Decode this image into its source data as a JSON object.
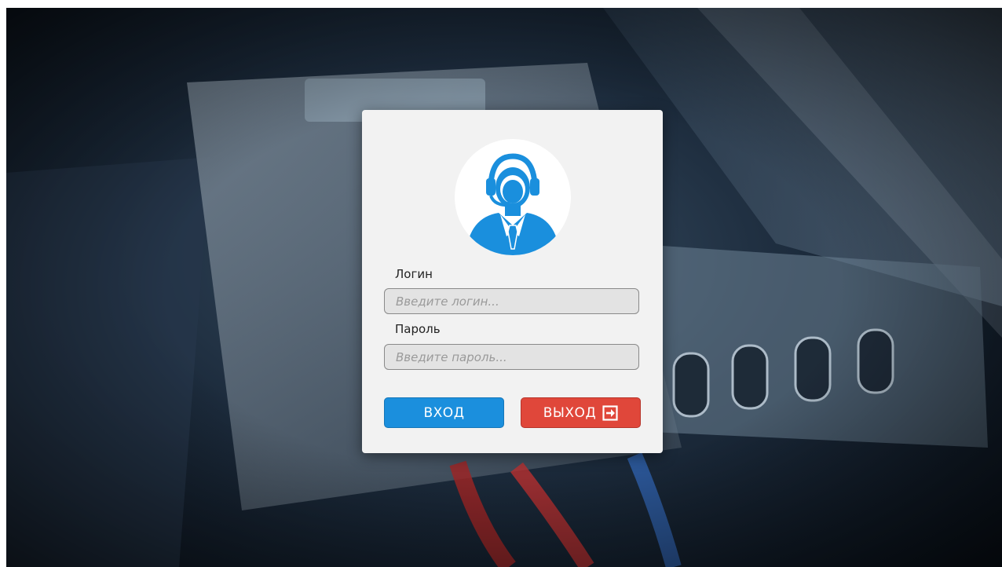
{
  "login_form": {
    "login_label": "Логин",
    "login_placeholder": "Введите логин...",
    "password_label": "Пароль",
    "password_placeholder": "Введите пароль...",
    "login_button": "ВХОД",
    "exit_button": "ВЫХОД"
  },
  "icons": {
    "avatar": "support-agent-icon",
    "exit": "sign-out-icon"
  },
  "colors": {
    "accent_blue": "#1b8fdd",
    "exit_red": "#e0473a",
    "card_background": "#f2f2f2"
  }
}
